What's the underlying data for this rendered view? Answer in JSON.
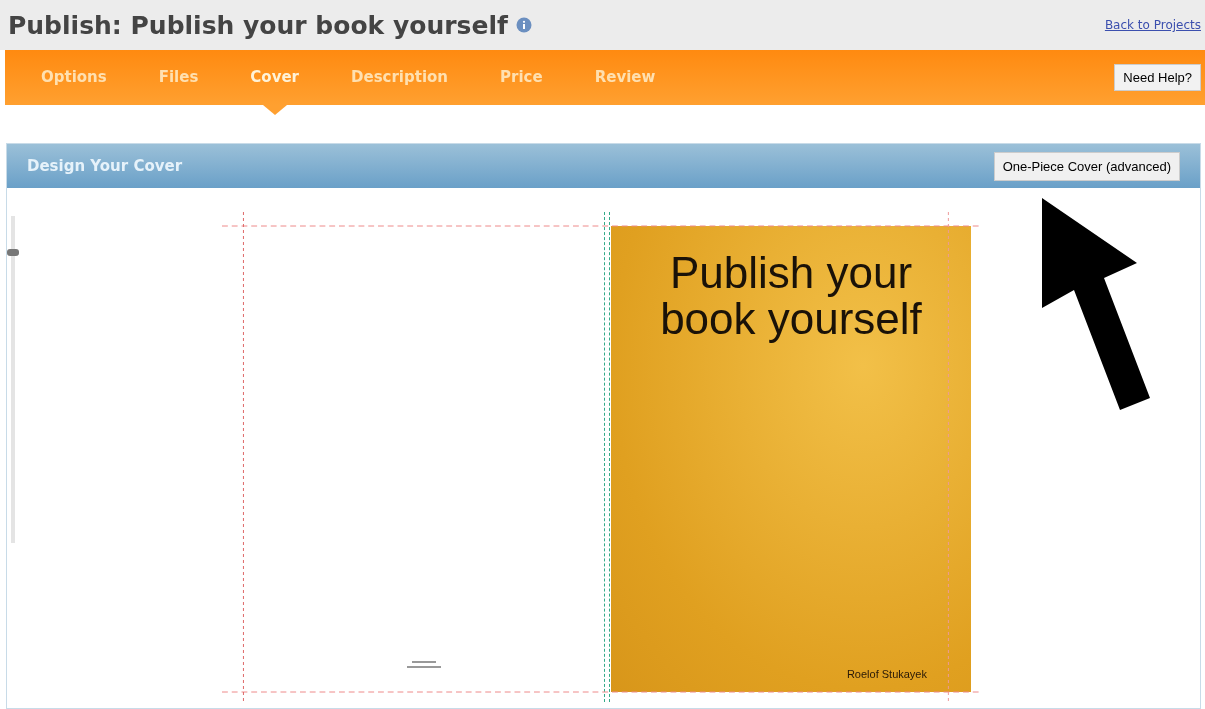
{
  "header": {
    "title": "Publish: Publish your book yourself",
    "back_link": "Back to Projects"
  },
  "tabs": [
    {
      "label": "Options",
      "selected": false
    },
    {
      "label": "Files",
      "selected": false
    },
    {
      "label": "Cover",
      "selected": true
    },
    {
      "label": "Description",
      "selected": false
    },
    {
      "label": "Price",
      "selected": false
    },
    {
      "label": "Review",
      "selected": false
    }
  ],
  "help_button": "Need Help?",
  "panel": {
    "title": "Design Your Cover",
    "advanced_button": "One-Piece Cover (advanced)"
  },
  "zoom_slider": {
    "level": 0.9
  },
  "cover": {
    "title": "Publish your book yourself",
    "author": "Roelof Stukayek"
  }
}
